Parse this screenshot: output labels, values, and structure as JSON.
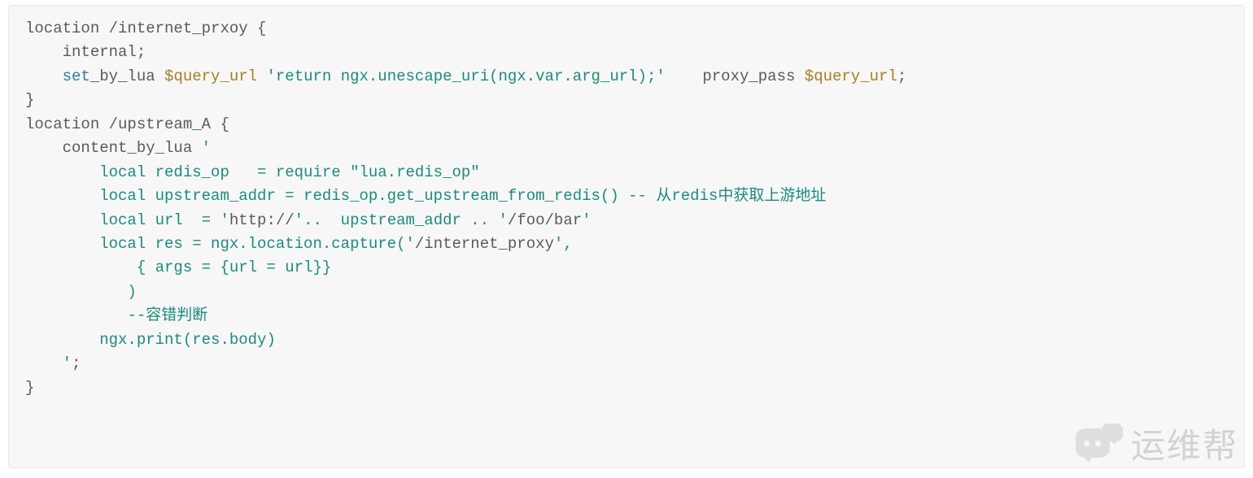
{
  "code": {
    "line1_a": "location /internet_prxoy {",
    "line2_a": "    internal;",
    "line3_a": "    ",
    "line3_set": "set",
    "line3_bylua": "_by_lua ",
    "line3_var": "$query_url",
    "line3_sp": " ",
    "line3_str": "'return ngx.unescape_uri(ngx.var.arg_url);'",
    "line3_pp": "    proxy_pass ",
    "line3_var2": "$query_url",
    "line3_end": ";",
    "line4_a": "}",
    "line5_a": "location /upstream_A {",
    "line6_a": "    content_by_lua ",
    "line6_str": "'",
    "line7_str": "        local redis_op   = require \"lua.redis_op\"",
    "line8_str": "        local upstream_addr = redis_op.get_upstream_from_redis() -- 从redis中获取上游地址",
    "line9_str": "        local url  = '",
    "line9_txt": "http://",
    "line9_str2": "'..  upstream_addr .. '",
    "line9_txt2": "/foo/bar",
    "line9_str3": "'",
    "line10_str": "        local res = ngx.location.capture('",
    "line10_txt": "/internet_proxy",
    "line10_str2": "',",
    "line11_str": "            { args = {url = url}}",
    "line12_str": "           )",
    "line13_str": "           --容错判断",
    "line14_str": "        ngx.print(res.body)",
    "line15_a": "    ",
    "line15_str": "'",
    "line15_end": ";",
    "line16_a": "}"
  },
  "watermark": {
    "text": "运维帮"
  }
}
